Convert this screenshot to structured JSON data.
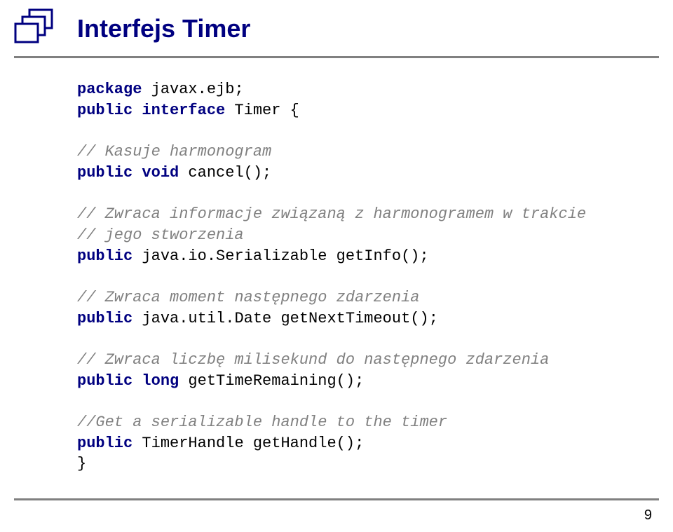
{
  "title": "Interfejs Timer",
  "code": {
    "l1a": "package",
    "l1b": " javax.ejb;",
    "l2a": "public interface",
    "l2b": " Timer {",
    "c1": "// Kasuje harmonogram",
    "l3a": "public void",
    "l3b": " cancel();",
    "c2a": "// Zwraca informacje związaną z harmonogramem w trakcie",
    "c2b": "// jego stworzenia",
    "l4a": "public",
    "l4b": " java.io.Serializable getInfo();",
    "c3": "// Zwraca moment następnego zdarzenia",
    "l5a": "public",
    "l5b": " java.util.Date getNextTimeout();",
    "c4": "// Zwraca liczbę milisekund do następnego zdarzenia",
    "l6a": "public long",
    "l6b": " getTimeRemaining();",
    "c5": "//Get a serializable handle to the timer",
    "l7a": "public",
    "l7b": " TimerHandle getHandle();",
    "l8": "}"
  },
  "page_number": "9"
}
